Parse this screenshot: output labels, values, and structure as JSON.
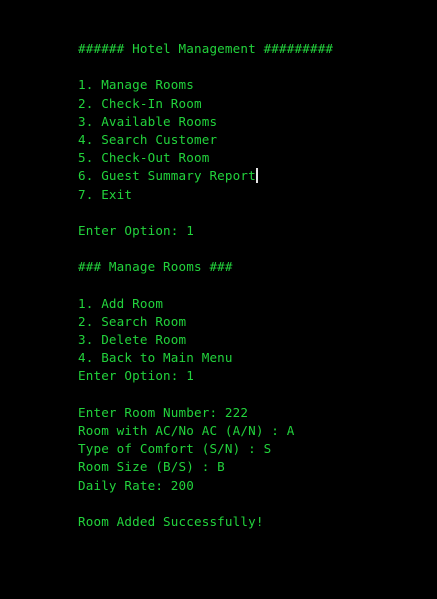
{
  "theme": {
    "background": "#000000",
    "text_color": "#22d33c",
    "cursor_color": "#e6e6e6"
  },
  "main_menu": {
    "title": "###### Hotel Management #########",
    "items": [
      "1. Manage Rooms",
      "2. Check-In Room",
      "3. Available Rooms",
      "4. Search Customer",
      "5. Check-Out Room",
      "6. Guest Summary Report",
      "7. Exit"
    ],
    "prompt": "Enter Option: 1"
  },
  "manage_rooms_menu": {
    "title": "### Manage Rooms ###",
    "items": [
      "1. Add Room",
      "2. Search Room",
      "3. Delete Room",
      "4. Back to Main Menu"
    ],
    "prompt": "Enter Option: 1"
  },
  "add_room_form": {
    "room_number": "Enter Room Number: 222",
    "ac": "Room with AC/No AC (A/N) : A",
    "comfort": "Type of Comfort (S/N) : S",
    "size": "Room Size (B/S) : B",
    "rate": "Daily Rate: 200"
  },
  "result": {
    "message": "Room Added Successfully!"
  }
}
